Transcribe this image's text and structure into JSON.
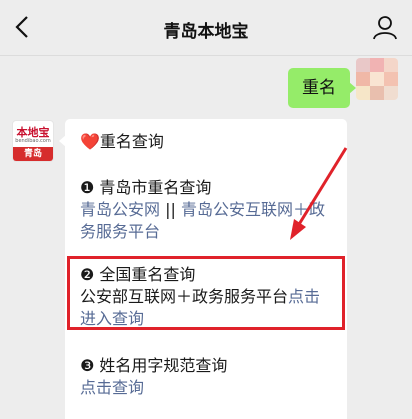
{
  "header": {
    "title": "青岛本地宝",
    "back_icon": "chevron-left-icon",
    "user_icon": "user-icon"
  },
  "sent_message": {
    "text": "重名"
  },
  "bot_avatar": {
    "top_text": "本地宝",
    "url_text": "bendibao.com",
    "city_text": "青岛"
  },
  "card": {
    "heading": "重名查询",
    "heart_glyph": "❤️",
    "item1": {
      "title": "❶ 青岛市重名查询",
      "link_a": "青岛公安网",
      "separator": " || ",
      "link_b_line1": "青岛公安互联网＋政",
      "link_b_line2": "务服务平台"
    },
    "item2": {
      "title": "❷ 全国重名查询",
      "text": "公安部互联网＋政务服务平台",
      "link_line1_end": "点击",
      "link_line2": "进入查询"
    },
    "item3": {
      "title": "❸ 姓名用字规范查询",
      "link": "点击查询"
    }
  },
  "colors": {
    "link": "#576b95",
    "bubble": "#95ec69",
    "highlight": "#e0222a"
  }
}
